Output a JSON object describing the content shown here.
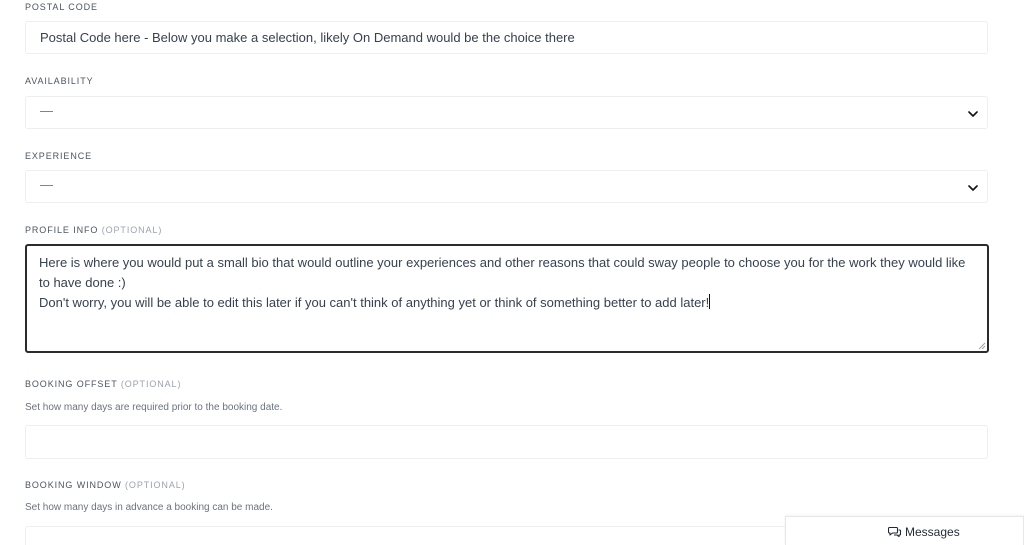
{
  "form": {
    "postal_code": {
      "label": "POSTAL CODE",
      "value": "Postal Code here - Below you make a selection, likely On Demand would be the choice there"
    },
    "availability": {
      "label": "AVAILABILITY",
      "selected": "—"
    },
    "experience": {
      "label": "EXPERIENCE",
      "selected": "—"
    },
    "profile_info": {
      "label": "PROFILE INFO",
      "optional": "(OPTIONAL)",
      "line1": "Here is where you would put a small bio that would outline your experiences and other reasons that could sway people to choose you for the work they would like to have done :)",
      "line2": "Don't worry, you will be able to edit this later if you can't think of anything yet or think of something better to add later!"
    },
    "booking_offset": {
      "label": "BOOKING OFFSET",
      "optional": "(OPTIONAL)",
      "help": "Set how many days are required prior to the booking date.",
      "value": ""
    },
    "booking_window": {
      "label": "BOOKING WINDOW",
      "optional": "(OPTIONAL)",
      "help": "Set how many days in advance a booking can be made.",
      "value": ""
    }
  },
  "messages": {
    "label": "Messages",
    "icon": "chat-bubbles-icon"
  }
}
